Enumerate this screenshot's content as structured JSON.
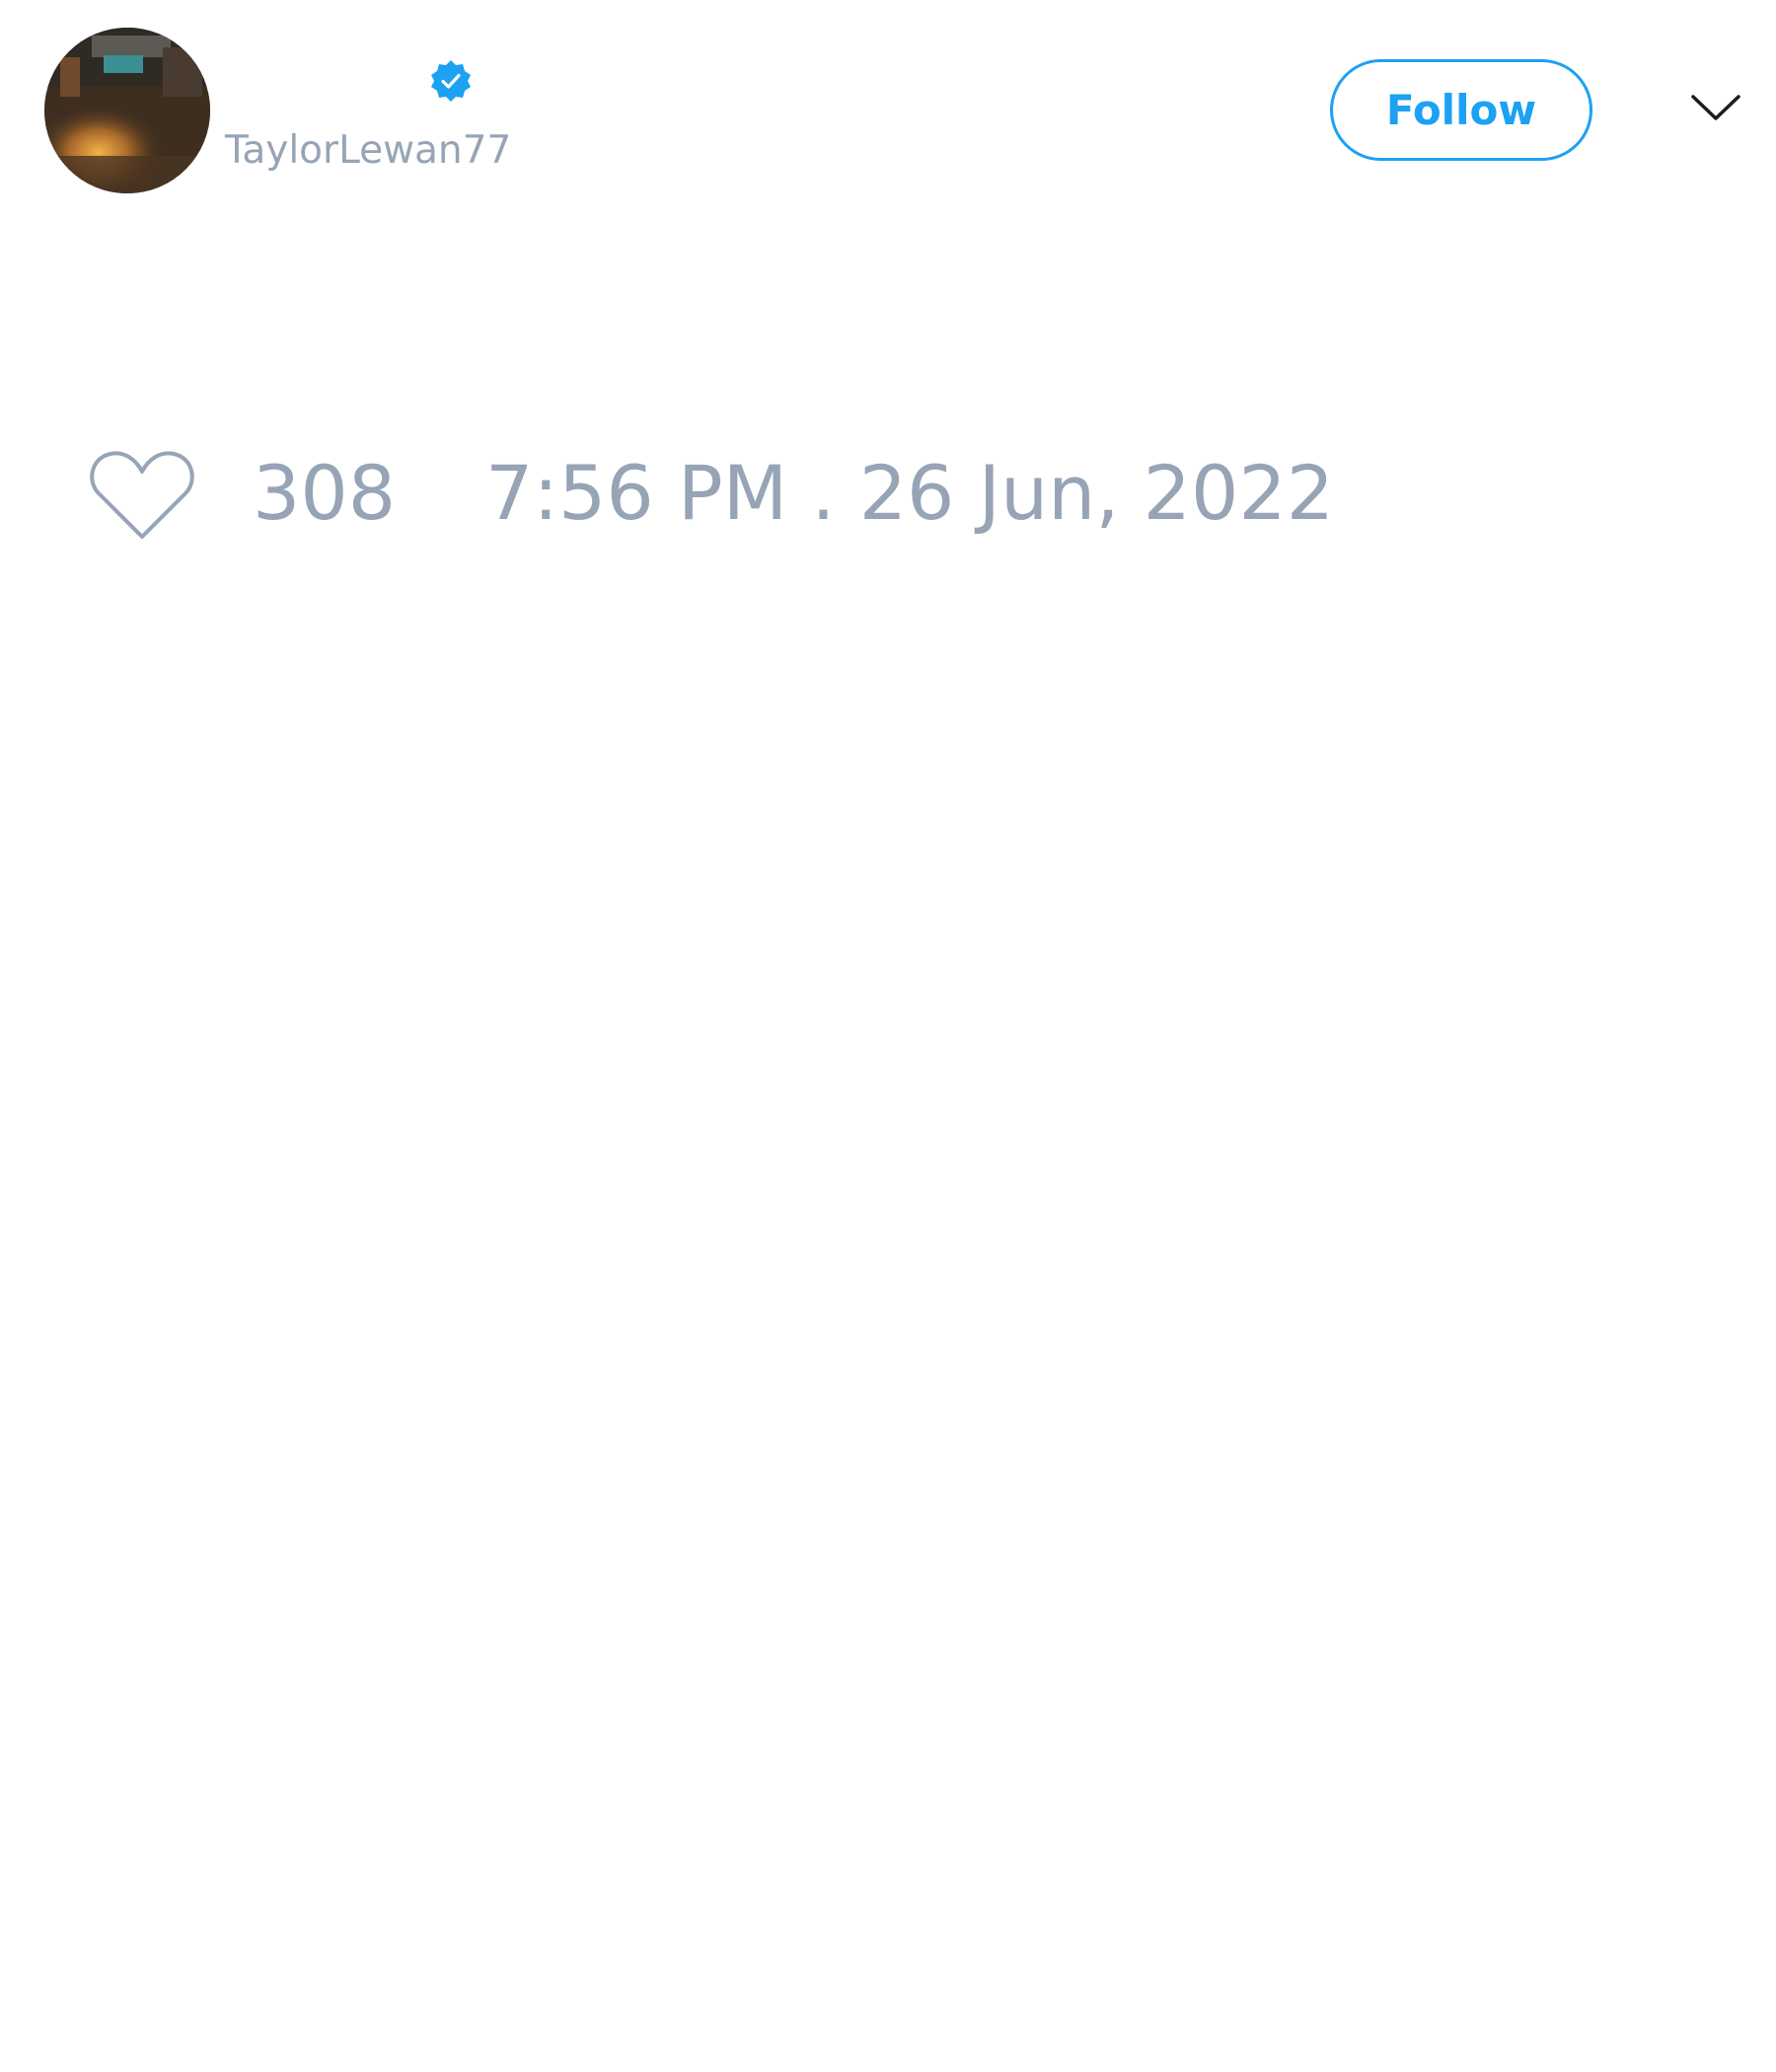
{
  "tweet": {
    "author": {
      "handle": "TaylorLewan77",
      "verified": true,
      "avatar_icon": "profile-photo"
    },
    "follow_button": {
      "label": "Follow"
    },
    "menu_icon": "chevron-down-icon",
    "likes": {
      "icon": "heart-outline-icon",
      "count": "308"
    },
    "timestamp": "7:56 PM . 26 Jun, 2022"
  },
  "colors": {
    "accent": "#1da1f2",
    "muted_text": "#96a4b6",
    "background": "#ffffff"
  }
}
